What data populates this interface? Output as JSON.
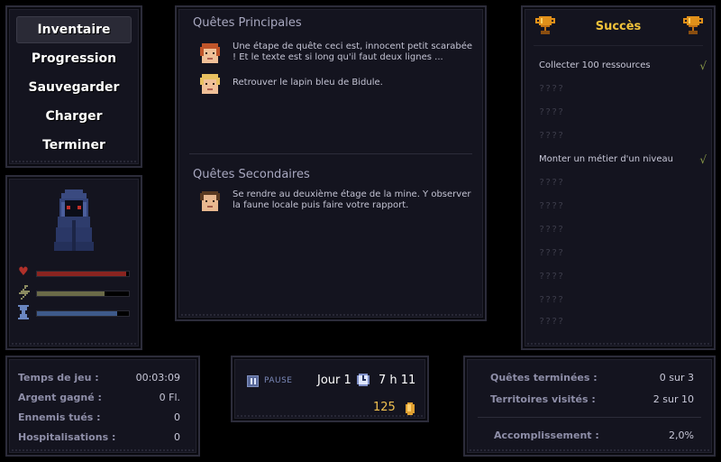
{
  "menu": {
    "items": [
      {
        "label": "Inventaire",
        "active": true
      },
      {
        "label": "Progression",
        "active": false
      },
      {
        "label": "Sauvegarder",
        "active": false
      },
      {
        "label": "Charger",
        "active": false
      },
      {
        "label": "Terminer",
        "active": false
      }
    ]
  },
  "character": {
    "bars": [
      {
        "icon": "heart-icon",
        "color": "#8a2420",
        "level": 0.97
      },
      {
        "icon": "lightning-icon",
        "color": "#6a6a48",
        "level": 0.74
      },
      {
        "icon": "hourglass-icon",
        "color": "#3e5a8a",
        "level": 0.87
      }
    ]
  },
  "quests": {
    "main_heading": "Quêtes Principales",
    "main": [
      {
        "text": "Une étape de quête ceci est, innocent petit scarabée ! Et le texte est si long qu'il faut deux lignes ...",
        "face": "red-hair-face-icon"
      },
      {
        "text": "Retrouver le lapin bleu de Bidule.",
        "face": "blond-face-icon"
      }
    ],
    "side_heading": "Quêtes Secondaires",
    "side": [
      {
        "text": "Se rendre au deuxième étage de la mine. Y observer la faune locale puis faire votre rapport.",
        "face": "brown-hair-face-icon"
      }
    ]
  },
  "achievements": {
    "title": "Succès",
    "items": [
      {
        "text": "Collecter 100 ressources",
        "done": true,
        "check": "√"
      },
      {
        "text": "????",
        "done": false
      },
      {
        "text": "????",
        "done": false
      },
      {
        "text": "????",
        "done": false
      },
      {
        "text": "Monter un métier d'un niveau",
        "done": true,
        "check": "√"
      },
      {
        "text": "????",
        "done": false
      },
      {
        "text": "????",
        "done": false
      },
      {
        "text": "????",
        "done": false
      },
      {
        "text": "????",
        "done": false
      },
      {
        "text": "????",
        "done": false
      },
      {
        "text": "????",
        "done": false
      },
      {
        "text": "????",
        "done": false
      }
    ]
  },
  "stats_left": [
    {
      "label": "Temps de jeu :",
      "value": "00:03:09"
    },
    {
      "label": "Argent gagné :",
      "value": "0 Fl."
    },
    {
      "label": "Ennemis tués :",
      "value": "0"
    },
    {
      "label": "Hospitalisations :",
      "value": "0"
    }
  ],
  "time": {
    "pause_label": "PAUSE",
    "day": "Jour 1",
    "clock": "7 h 11",
    "money": "125"
  },
  "stats_right": {
    "rows": [
      {
        "label": "Quêtes terminées :",
        "value": "0 sur 3"
      },
      {
        "label": "Territoires visités :",
        "value": "2 sur 10"
      }
    ],
    "total_label": "Accomplissement :",
    "total_value": "2,0%"
  }
}
